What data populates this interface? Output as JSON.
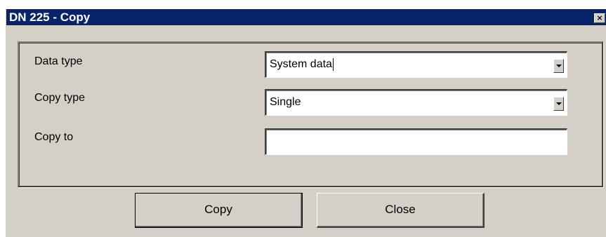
{
  "window": {
    "title": "DN 225 - Copy",
    "close_glyph": "×",
    "close_icon": "close-icon"
  },
  "form": {
    "data_type": {
      "label": "Data type",
      "value": "System data",
      "dropdown_icon": "chevron-down-icon"
    },
    "copy_type": {
      "label": "Copy type",
      "value": "Single",
      "dropdown_icon": "chevron-down-icon"
    },
    "copy_to": {
      "label": "Copy to",
      "value": ""
    }
  },
  "buttons": {
    "copy_label": "Copy",
    "close_label": "Close"
  },
  "colors": {
    "titlebar": "#0a246a",
    "face": "#d4d0c8"
  }
}
